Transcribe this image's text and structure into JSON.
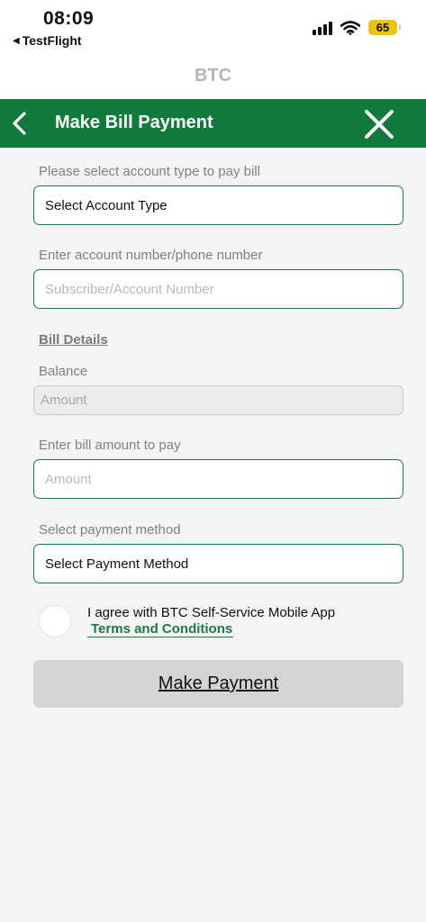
{
  "status_bar": {
    "time": "08:09",
    "back_app": "TestFlight",
    "battery": "65"
  },
  "app": {
    "title": "BTC"
  },
  "header": {
    "title": "Make Bill Payment"
  },
  "form": {
    "account_type": {
      "label": "Please select account type to pay bill",
      "value": "Select Account Type"
    },
    "account_number": {
      "label": "Enter account number/phone number",
      "placeholder": "Subscriber/Account Number"
    },
    "bill_details": {
      "title": "Bill Details",
      "balance_label": "Balance",
      "balance_placeholder": "Amount"
    },
    "bill_amount": {
      "label": "Enter bill amount to pay",
      "placeholder": "Amount"
    },
    "payment_method": {
      "label": "Select payment method",
      "value": "Select Payment Method"
    },
    "agree": {
      "text": "I agree with BTC Self-Service Mobile App",
      "link": "Terms and Conditions"
    },
    "submit_label": "Make Payment"
  },
  "colors": {
    "brand_green": "#0f7a3a",
    "field_border": "#1d7a43",
    "battery": "#e8c413",
    "button_bg": "#d4d4d4"
  },
  "icons": {
    "back": "chevron-left-icon",
    "close": "close-icon",
    "signal": "cellular-signal-icon",
    "wifi": "wifi-icon",
    "battery": "battery-icon"
  }
}
